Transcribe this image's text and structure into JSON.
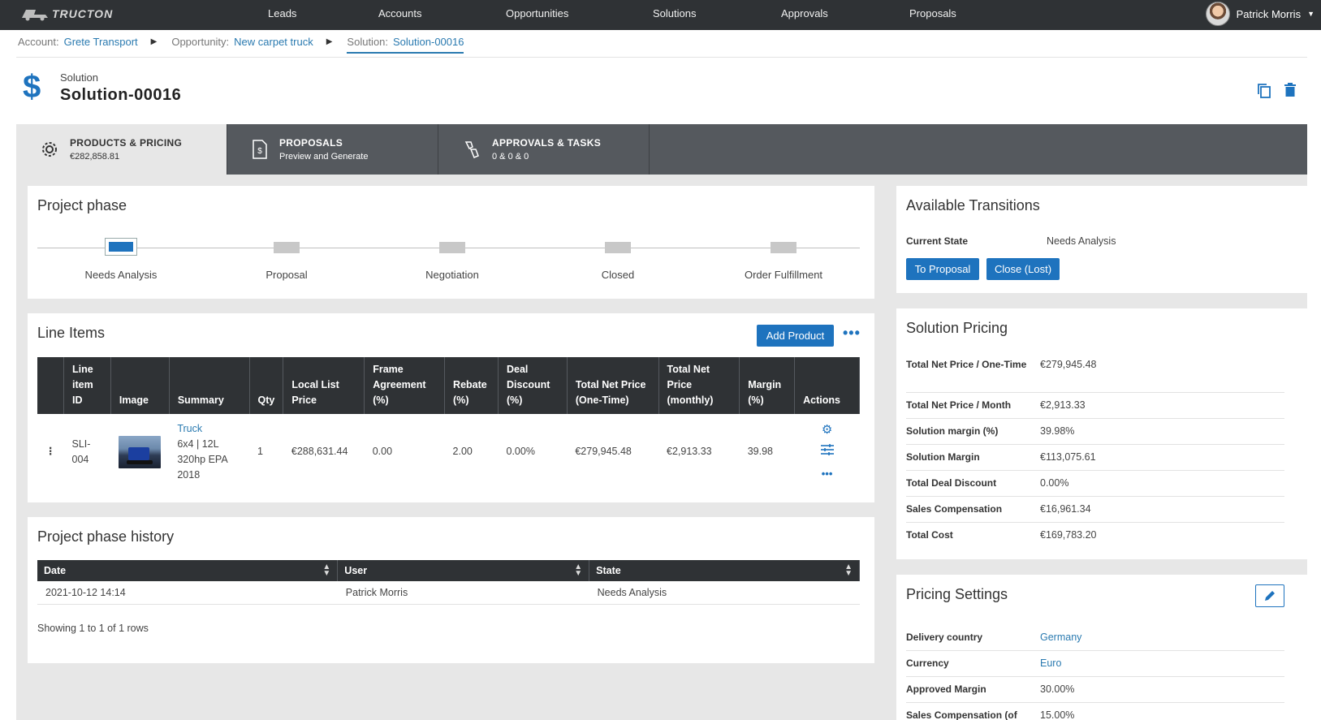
{
  "app": {
    "logo_text": "TRUCTON"
  },
  "nav": {
    "items": [
      "Leads",
      "Accounts",
      "Opportunities",
      "Solutions",
      "Approvals",
      "Proposals"
    ],
    "user_name": "Patrick Morris"
  },
  "breadcrumb": {
    "account_label": "Account:",
    "account_value": "Grete Transport",
    "opportunity_label": "Opportunity:",
    "opportunity_value": "New carpet truck",
    "solution_label": "Solution:",
    "solution_value": "Solution-00016"
  },
  "header": {
    "kind": "Solution",
    "title": "Solution-00016"
  },
  "tabs": [
    {
      "title": "PRODUCTS & PRICING",
      "sub": "€282,858.81"
    },
    {
      "title": "PROPOSALS",
      "sub": "Preview and Generate"
    },
    {
      "title": "APPROVALS & TASKS",
      "sub": "0 & 0 & 0"
    }
  ],
  "project_phase": {
    "title": "Project phase",
    "current": "Needs Analysis",
    "phases": [
      "Needs Analysis",
      "Proposal",
      "Negotiation",
      "Closed",
      "Order Fulfillment"
    ]
  },
  "line_items": {
    "title": "Line Items",
    "add_label": "Add Product",
    "columns": [
      "",
      "Line item ID",
      "Image",
      "Summary",
      "Qty",
      "Local List Price",
      "Frame Agreement (%)",
      "Rebate (%)",
      "Deal Discount (%)",
      "Total Net Price (One-Time)",
      "Total Net Price (monthly)",
      "Margin (%)",
      "Actions"
    ],
    "rows": [
      {
        "id": "SLI-004",
        "summary_link": "Truck",
        "summary_text": "6x4 | 12L 320hp EPA 2018",
        "qty": "1",
        "list_price": "€288,631.44",
        "frame": "0.00",
        "rebate": "2.00",
        "deal_discount": "0.00%",
        "net_one_time": "€279,945.48",
        "net_monthly": "€2,913.33",
        "margin": "39.98"
      }
    ]
  },
  "history": {
    "title": "Project phase history",
    "columns": [
      "Date",
      "User",
      "State"
    ],
    "rows": [
      {
        "date": "2021-10-12 14:14",
        "user": "Patrick Morris",
        "state": "Needs Analysis"
      }
    ],
    "footer": "Showing 1 to 1 of 1 rows"
  },
  "transitions": {
    "title": "Available Transitions",
    "current_label": "Current State",
    "current_value": "Needs Analysis",
    "buttons": [
      "To Proposal",
      "Close (Lost)"
    ]
  },
  "solution_pricing": {
    "title": "Solution Pricing",
    "rows": [
      {
        "k": "Total Net Price / One-Time",
        "v": "€279,945.48"
      },
      {
        "k": "Total Net Price / Month",
        "v": "€2,913.33"
      },
      {
        "k": "Solution margin (%)",
        "v": "39.98%"
      },
      {
        "k": "Solution Margin",
        "v": "€113,075.61"
      },
      {
        "k": "Total Deal Discount",
        "v": "0.00%"
      },
      {
        "k": "Sales Compensation",
        "v": "€16,961.34"
      },
      {
        "k": "Total Cost",
        "v": "€169,783.20"
      }
    ]
  },
  "pricing_settings": {
    "title": "Pricing Settings",
    "rows": [
      {
        "k": "Delivery country",
        "v": "Germany"
      },
      {
        "k": "Currency",
        "v": "Euro"
      },
      {
        "k": "Approved Margin",
        "v": "30.00%"
      },
      {
        "k": "Sales Compensation (of",
        "v": "15.00%"
      }
    ]
  },
  "colors": {
    "accent": "#1e73be",
    "nav_bg": "#2f3235",
    "tab_bg": "#55595e",
    "content_bg": "#e7e7e7"
  }
}
